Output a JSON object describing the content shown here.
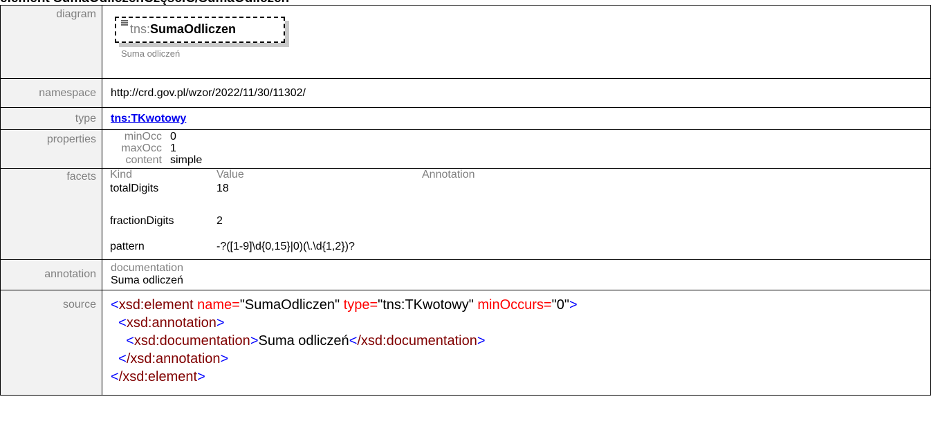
{
  "title_text": "element SumaOdliczenCzęściC/SumaOdliczen",
  "labels": {
    "diagram": "diagram",
    "namespace": "namespace",
    "type": "type",
    "properties": "properties",
    "facets": "facets",
    "annotation": "annotation",
    "source": "source"
  },
  "diagram": {
    "prefix": "tns:",
    "name": "SumaOdliczen",
    "caption": "Suma odliczeń"
  },
  "namespace_value": "http://crd.gov.pl/wzor/2022/11/30/11302/",
  "type_value": "tns:TKwotowy",
  "properties": [
    {
      "key": "minOcc",
      "value": "0"
    },
    {
      "key": "maxOcc",
      "value": "1"
    },
    {
      "key": "content",
      "value": "simple"
    }
  ],
  "facets": {
    "headers": {
      "kind": "Kind",
      "value": "Value",
      "annotation": "Annotation"
    },
    "rows": [
      {
        "kind": "totalDigits",
        "value": "18",
        "annotation": ""
      },
      {
        "kind": "fractionDigits",
        "value": "2",
        "annotation": ""
      },
      {
        "kind": "pattern",
        "value": "-?([1-9]\\d{0,15}|0)(\\.\\d{1,2})?",
        "annotation": ""
      }
    ]
  },
  "annotation": {
    "key": "documentation",
    "value": "Suma odliczeń"
  },
  "source": {
    "l1_open": "<",
    "l1_tag": "xsd:element",
    "l1_a1": "name=",
    "l1_v1": "\"SumaOdliczen\"",
    "l1_a2": "type=",
    "l1_v2": "\"tns:TKwotowy\"",
    "l1_a3": "minOccurs=",
    "l1_v3": "\"0\"",
    "l1_close": ">",
    "l2_tag": "xsd:annotation",
    "l3_tag": "xsd:documentation",
    "l3_text": "Suma odliczeń",
    "l3_endtag": "/xsd:documentation",
    "l4_endtag": "/xsd:annotation",
    "l5_endtag": "/xsd:element"
  }
}
